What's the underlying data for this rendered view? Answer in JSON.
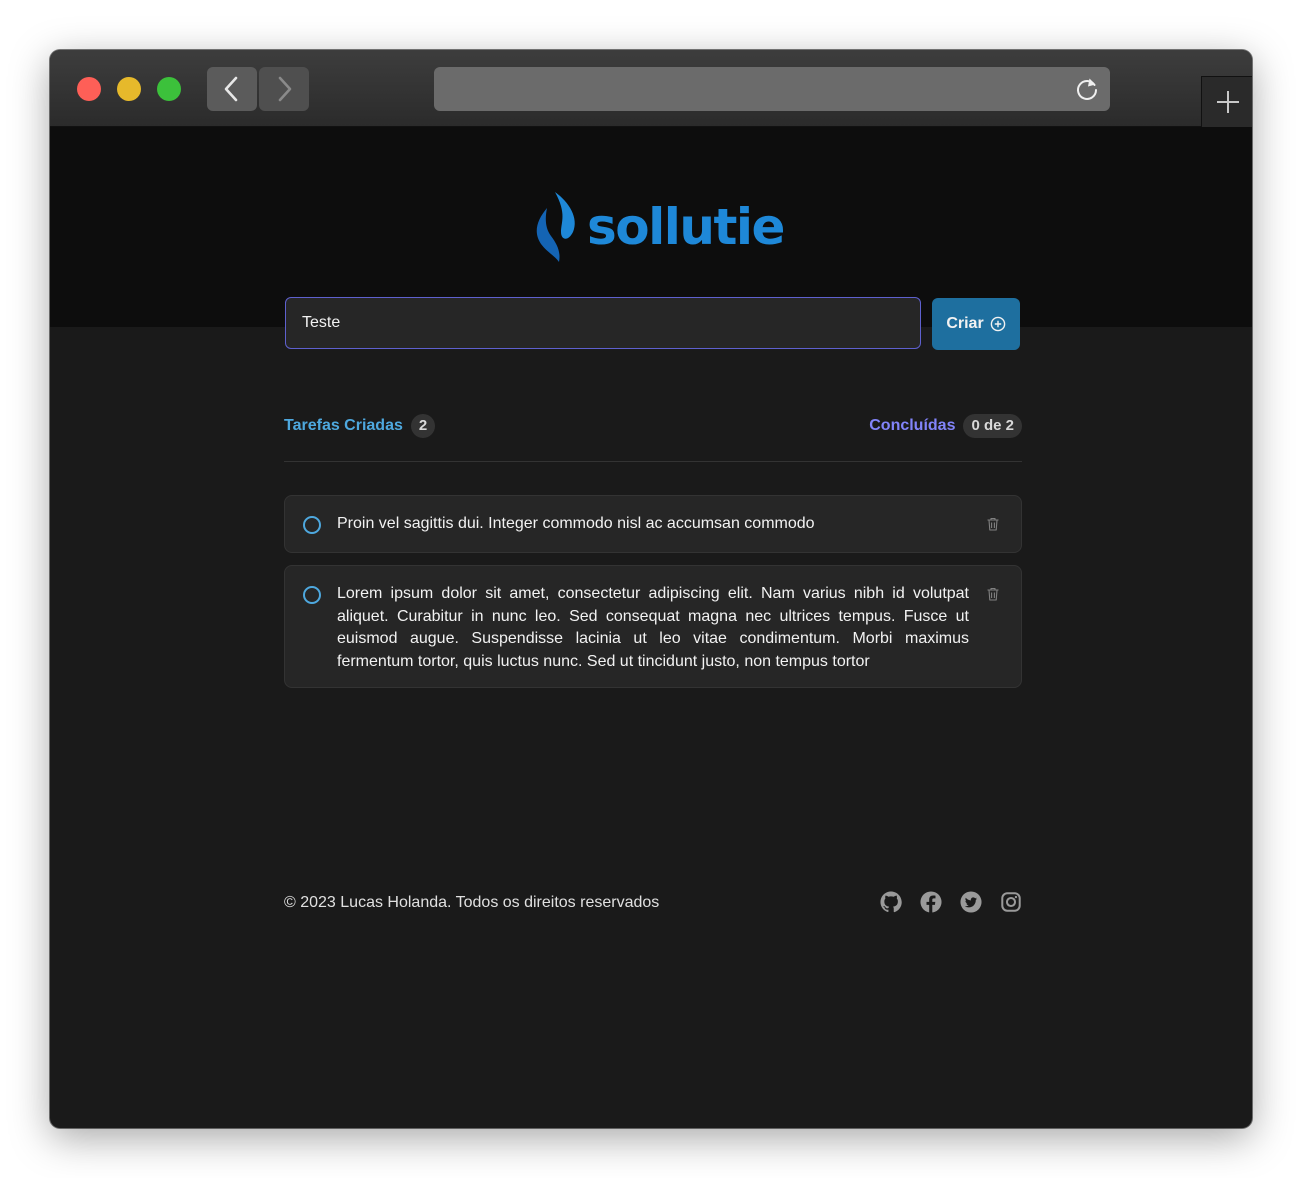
{
  "browser": {
    "back_icon": "chevron-left-icon",
    "forward_icon": "chevron-right-icon",
    "reload_icon": "reload-icon",
    "new_tab_icon": "plus-icon"
  },
  "logo": {
    "text": "sollutie",
    "icon": "flame-logo-icon",
    "color": "#1e88d8"
  },
  "form": {
    "input_value": "Teste",
    "create_label": "Criar",
    "create_icon": "plus-circle-icon",
    "accent": "#1e6f9f"
  },
  "stats": {
    "created_label": "Tarefas Criadas",
    "created_count": "2",
    "done_label": "Concluídas",
    "done_count": "0 de 2"
  },
  "tasks": [
    {
      "text": "Proin vel sagittis dui. Integer commodo nisl ac accumsan commodo",
      "done": false
    },
    {
      "text": "Lorem ipsum dolor sit amet, consectetur adipiscing elit. Nam varius nibh id volutpat aliquet. Curabitur in nunc leo. Sed consequat magna nec ultrices tempus. Fusce ut euismod augue. Suspendisse lacinia ut leo vitae condimentum. Morbi maximus fermentum tortor, quis luctus nunc. Sed ut tincidunt justo, non tempus tortor",
      "done": false
    }
  ],
  "footer": {
    "copyright": "© 2023 Lucas Holanda. Todos os direitos reservados",
    "socials": [
      "github-icon",
      "facebook-icon",
      "twitter-icon",
      "instagram-icon"
    ]
  }
}
